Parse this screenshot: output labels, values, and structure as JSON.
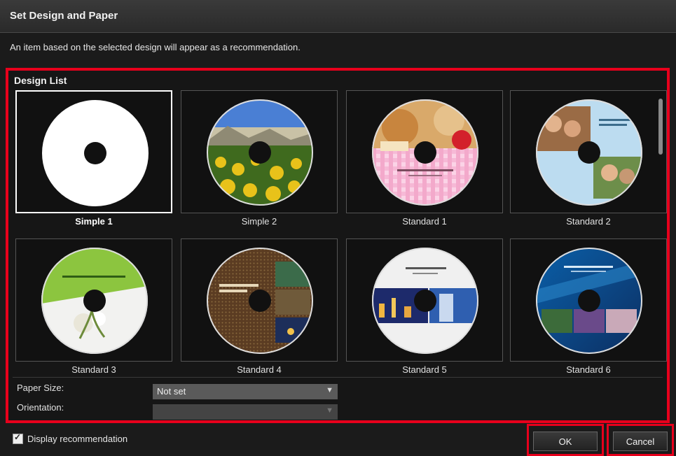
{
  "window": {
    "title": "Set Design and Paper"
  },
  "description": "An item based on the selected design will appear as a recommendation.",
  "design_list": {
    "label": "Design List",
    "items": [
      {
        "label": "Simple 1",
        "selected": true
      },
      {
        "label": "Simple 2",
        "selected": false
      },
      {
        "label": "Standard 1",
        "selected": false
      },
      {
        "label": "Standard 2",
        "selected": false
      },
      {
        "label": "Standard 3",
        "selected": false
      },
      {
        "label": "Standard 4",
        "selected": false
      },
      {
        "label": "Standard 5",
        "selected": false
      },
      {
        "label": "Standard 6",
        "selected": false
      }
    ]
  },
  "paper_size": {
    "label": "Paper Size:",
    "value": "Not set"
  },
  "orientation": {
    "label": "Orientation:",
    "value": ""
  },
  "display_recommendation": {
    "label": "Display recommendation",
    "checked": true
  },
  "buttons": {
    "ok": "OK",
    "cancel": "Cancel"
  },
  "colors": {
    "highlight": "#e8001c",
    "background": "#1b1b1b"
  }
}
